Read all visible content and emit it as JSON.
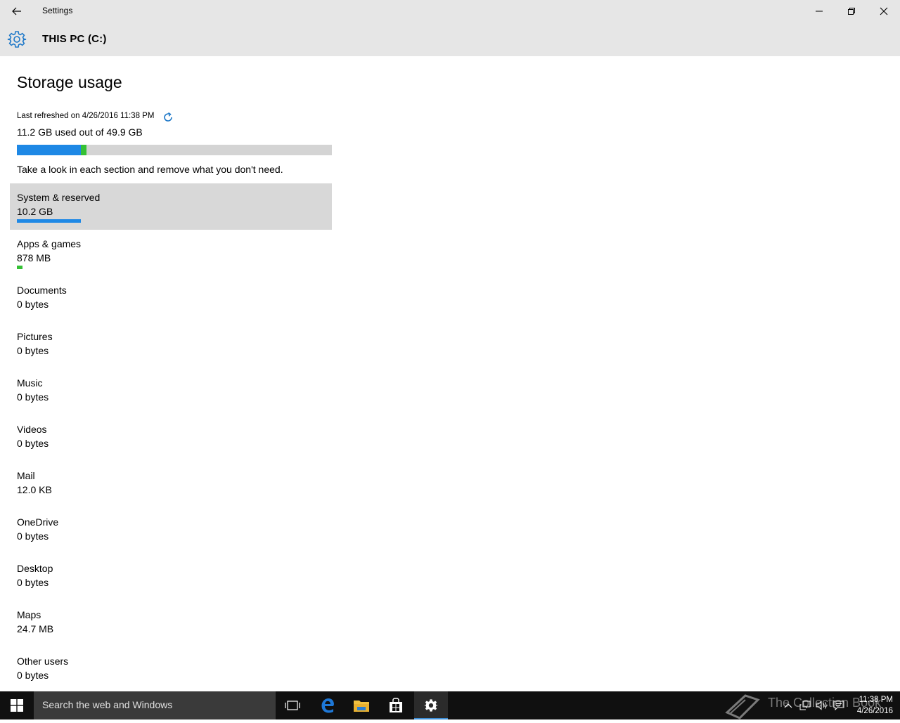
{
  "window": {
    "title": "Settings"
  },
  "header": {
    "title": "THIS PC (C:)",
    "icon": "gear-icon"
  },
  "main": {
    "title": "Storage usage",
    "last_refreshed": "Last refreshed on 4/26/2016 11:38 PM",
    "used_summary": "11.2 GB used out of 49.9 GB",
    "usage_fraction": {
      "system": 0.204,
      "apps": 0.0176
    },
    "hint": "Take a look in each section and remove what you don't need.",
    "categories": [
      {
        "name": "System & reserved",
        "size": "10.2 GB",
        "selected": true,
        "fill": 0.204
      },
      {
        "name": "Apps & games",
        "size": "878 MB",
        "fill": 0.0176
      },
      {
        "name": "Documents",
        "size": "0 bytes"
      },
      {
        "name": "Pictures",
        "size": "0 bytes"
      },
      {
        "name": "Music",
        "size": "0 bytes"
      },
      {
        "name": "Videos",
        "size": "0 bytes"
      },
      {
        "name": "Mail",
        "size": "12.0 KB"
      },
      {
        "name": "OneDrive",
        "size": "0 bytes"
      },
      {
        "name": "Desktop",
        "size": "0 bytes"
      },
      {
        "name": "Maps",
        "size": "24.7 MB"
      },
      {
        "name": "Other users",
        "size": "0 bytes"
      }
    ]
  },
  "taskbar": {
    "search_placeholder": "Search the web and Windows",
    "watermark": "The Collection Book",
    "clock_time": "11:38 PM",
    "clock_date": "4/26/2016"
  },
  "colors": {
    "accent": "#1e88e5",
    "system_bar": "#1e88e5",
    "apps_bar": "#35c135",
    "bar_track": "#d4d4d4",
    "chrome": "#e6e6e6",
    "selected_row": "#d8d8d8",
    "taskbar": "#101010"
  }
}
